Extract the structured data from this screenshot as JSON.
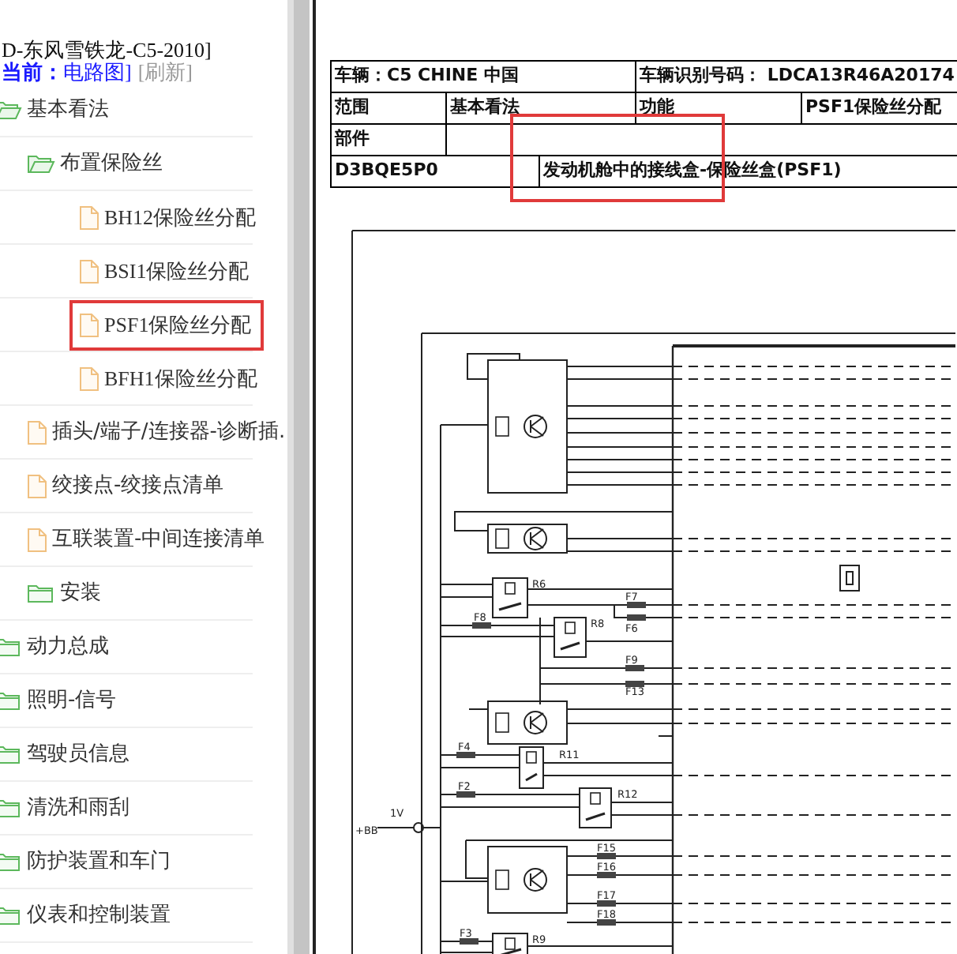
{
  "breadcrumb": {
    "path": "D-东风雪铁龙-C5-2010]",
    "current_label": "当前：",
    "current_value": "电路图]",
    "refresh": "[刷新]"
  },
  "tree": [
    {
      "label": "基本看法",
      "kind": "folder",
      "expanded": true,
      "selected": false,
      "children": [
        {
          "label": "布置保险丝",
          "kind": "folder",
          "expanded": true,
          "selected": false,
          "children": [
            {
              "label": "BH12保险丝分配",
              "kind": "file",
              "selected": false
            },
            {
              "label": "BSI1保险丝分配",
              "kind": "file",
              "selected": false
            },
            {
              "label": "PSF1保险丝分配",
              "kind": "file",
              "selected": true
            },
            {
              "label": "BFH1保险丝分配",
              "kind": "file",
              "selected": false
            }
          ]
        },
        {
          "label": "插头/端子/连接器-诊断插.",
          "kind": "file",
          "selected": false
        },
        {
          "label": "绞接点-绞接点清单",
          "kind": "file",
          "selected": false
        },
        {
          "label": "互联装置-中间连接清单",
          "kind": "file",
          "selected": false
        },
        {
          "label": "安装",
          "kind": "folder",
          "expanded": false,
          "selected": false
        }
      ]
    },
    {
      "label": "动力总成",
      "kind": "folder",
      "expanded": false,
      "selected": false
    },
    {
      "label": "照明-信号",
      "kind": "folder",
      "expanded": false,
      "selected": false
    },
    {
      "label": "驾驶员信息",
      "kind": "folder",
      "expanded": false,
      "selected": false
    },
    {
      "label": "清洗和雨刮",
      "kind": "folder",
      "expanded": false,
      "selected": false
    },
    {
      "label": "防护装置和车门",
      "kind": "folder",
      "expanded": false,
      "selected": false
    },
    {
      "label": "仪表和控制装置",
      "kind": "folder",
      "expanded": false,
      "selected": false
    }
  ],
  "document": {
    "info_table": {
      "vehicle": "车辆：C5 CHINE 中国",
      "vin": "车辆识别号码： LDCA13R46A20174",
      "scope_label": "范围",
      "scope": "基本看法",
      "function_label": "功能",
      "function": "PSF1保险丝分配",
      "part_label": "部件",
      "code": "D3BQE5P0",
      "part": "发动机舱中的接线盒-保险丝盒(PSF1)"
    },
    "diagram": {
      "labels": [
        "R6",
        "F7",
        "F6",
        "R8",
        "F8",
        "F9",
        "F13",
        "R11",
        "F4",
        "R12",
        "F2",
        "1V",
        "+BB",
        "F15",
        "F16",
        "F17",
        "F18",
        "R9",
        "F3"
      ]
    }
  }
}
